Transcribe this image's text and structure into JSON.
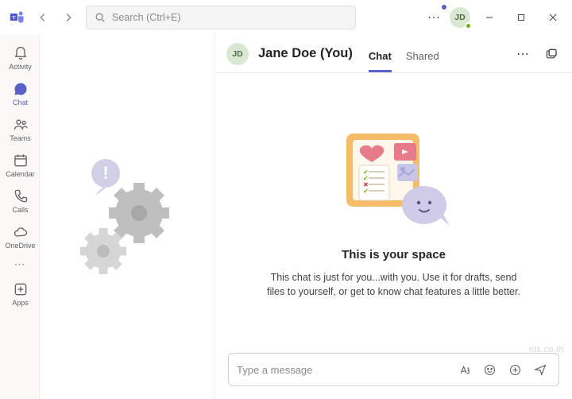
{
  "titlebar": {
    "search_placeholder": "Search (Ctrl+E)",
    "avatar_initials": "JD"
  },
  "rail": {
    "items": [
      {
        "label": "Activity"
      },
      {
        "label": "Chat"
      },
      {
        "label": "Teams"
      },
      {
        "label": "Calendar"
      },
      {
        "label": "Calls"
      },
      {
        "label": "OneDrive"
      }
    ],
    "apps_label": "Apps"
  },
  "chat": {
    "avatar_initials": "JD",
    "title": "Jane Doe (You)",
    "tabs": [
      {
        "label": "Chat"
      },
      {
        "label": "Shared"
      }
    ],
    "empty_title": "This is your space",
    "empty_body": "This chat is just for you...with you. Use it for drafts, send files to yourself, or get to know chat features a little better.",
    "composer_placeholder": "Type a message"
  },
  "watermark": "nts.co.th"
}
